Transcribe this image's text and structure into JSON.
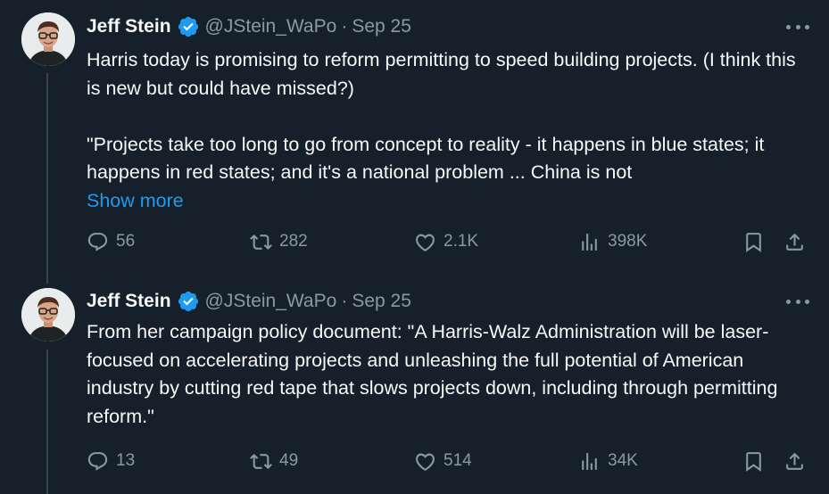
{
  "tweets": [
    {
      "author": "Jeff Stein",
      "handle": "@JStein_WaPo",
      "separator": "·",
      "date": "Sep 25",
      "paragraphs": [
        "Harris today is promising to reform permitting to speed building projects. (I think this is new but could have missed?)",
        "\"Projects take too long to go from concept to reality - it happens in blue states; it happens in red states; and it's a national problem ... China is not"
      ],
      "show_more": "Show more",
      "replies": "56",
      "reposts": "282",
      "likes": "2.1K",
      "views": "398K"
    },
    {
      "author": "Jeff Stein",
      "handle": "@JStein_WaPo",
      "separator": "·",
      "date": "Sep 25",
      "paragraphs": [
        "From her campaign policy document: \"A Harris-Walz Administration will be laser-focused on accelerating projects and unleashing the full potential of American industry by cutting red tape that slows projects down, including through permitting reform.\""
      ],
      "replies": "13",
      "reposts": "49",
      "likes": "514",
      "views": "34K"
    }
  ],
  "icons": {
    "verified": "verified-badge-icon",
    "more": "more-icon",
    "reply": "reply-icon",
    "repost": "repost-icon",
    "like": "heart-icon",
    "views": "views-icon",
    "bookmark": "bookmark-icon",
    "share": "share-icon"
  },
  "colors": {
    "background": "#15202b",
    "text": "#f7f9f9",
    "muted": "#8b98a5",
    "accent": "#1d9bf0"
  }
}
